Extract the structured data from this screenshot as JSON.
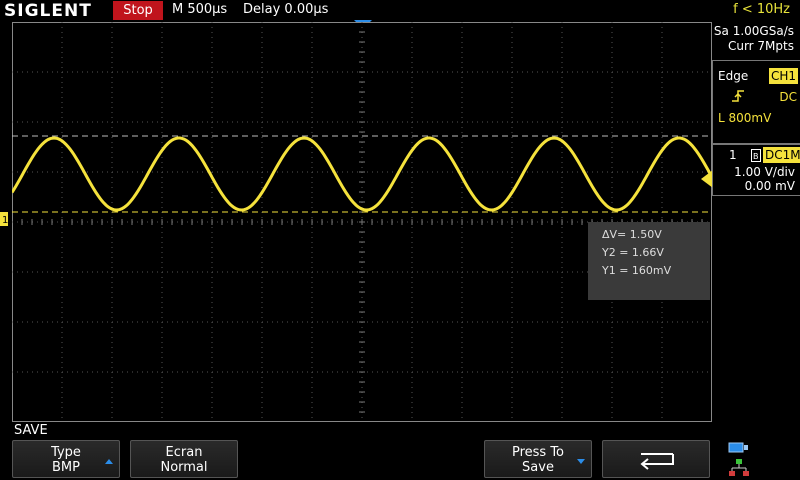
{
  "header": {
    "logo": "SIGLENT",
    "run_state": "Stop",
    "timebase": "M 500μs",
    "delay": "Delay 0.00μs",
    "frequency": "f < 10Hz"
  },
  "acquisition": {
    "sample_rate": "Sa 1.00GSa/s",
    "memory": "Curr 7Mpts"
  },
  "trigger": {
    "type": "Edge",
    "source": "CH1",
    "coupling": "DC",
    "level": "L  800mV"
  },
  "channel": {
    "number": "1",
    "coupling": "DC1M",
    "scale": "1.00 V/div",
    "offset": "0.00 mV"
  },
  "measure": {
    "delta_v": "ΔV= 1.50V",
    "y2": "Y2 = 1.66V",
    "y1": "Y1 = 160mV"
  },
  "menu": {
    "title": "SAVE",
    "type_label": "Type",
    "type_value": "BMP",
    "ecran_label": "Ecran",
    "ecran_value": "Normal",
    "press_label": "Press To",
    "press_value": "Save"
  },
  "colors": {
    "trace": "#f5e23c",
    "stop": "#c0141c",
    "accent": "#2b8de9"
  }
}
